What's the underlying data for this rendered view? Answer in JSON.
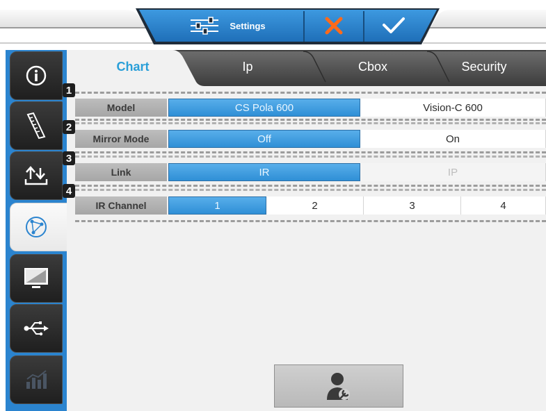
{
  "header": {
    "settings_label": "Settings",
    "icons": [
      "sliders-icon",
      "close-icon",
      "check-icon"
    ],
    "colors": {
      "bar": "#2b84cf",
      "cancel": "#ff6a1a",
      "confirm": "#ffffff"
    }
  },
  "sidebar": {
    "items": [
      {
        "name": "info",
        "icon": "info-icon",
        "active": false
      },
      {
        "name": "ruler",
        "icon": "ruler-icon",
        "active": false
      },
      {
        "name": "transfer",
        "icon": "transfer-icon",
        "active": false
      },
      {
        "name": "network",
        "icon": "network-icon",
        "active": true
      },
      {
        "name": "display",
        "icon": "display-icon",
        "active": false
      },
      {
        "name": "usb",
        "icon": "usb-icon",
        "active": false
      },
      {
        "name": "statistics",
        "icon": "chart-icon",
        "active": false
      }
    ]
  },
  "tabs": [
    {
      "label": "Chart",
      "active": true
    },
    {
      "label": "Ip",
      "active": false
    },
    {
      "label": "Cbox",
      "active": false
    },
    {
      "label": "Security",
      "active": false
    }
  ],
  "rows": [
    {
      "badge": "1",
      "label": "Model",
      "options": [
        "CS Pola 600",
        "Vision-C 600"
      ],
      "selected": "CS Pola 600"
    },
    {
      "badge": "2",
      "label": "Mirror Mode",
      "options": [
        "Off",
        "On"
      ],
      "selected": "Off"
    },
    {
      "badge": "3",
      "label": "Link",
      "options": [
        "IR",
        "IP"
      ],
      "selected": "IR",
      "disabled": [
        "IP"
      ]
    },
    {
      "badge": "4",
      "label": "IR Channel",
      "options": [
        "1",
        "2",
        "3",
        "4"
      ],
      "selected": "1"
    }
  ],
  "service_button": {
    "icon": "service-technician-icon"
  },
  "colors": {
    "accent": "#2a9fd8",
    "sidebar": "#2b84cf",
    "selected_option": "#3d9ddf"
  }
}
